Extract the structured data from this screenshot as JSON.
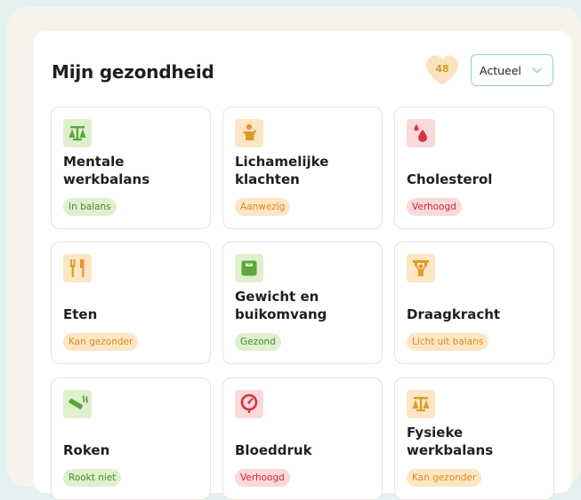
{
  "page": {
    "title": "Mijn gezondheid"
  },
  "score": {
    "value": "48"
  },
  "filter": {
    "selected": "Actueel"
  },
  "cards": [
    {
      "title": "Mentale werkbalans",
      "status": "In balans",
      "icon": "balance-scale-icon"
    },
    {
      "title": "Lichamelijke klachten",
      "status": "Aanwezig",
      "icon": "body-complaint-icon"
    },
    {
      "title": "Cholesterol",
      "status": "Verhoogd",
      "icon": "blood-drops-icon"
    },
    {
      "title": "Eten",
      "status": "Kan gezonder",
      "icon": "fork-knife-icon"
    },
    {
      "title": "Gewicht en buikomvang",
      "status": "Gezond",
      "icon": "weight-scale-icon"
    },
    {
      "title": "Draagkracht",
      "status": "Licht uit balans",
      "icon": "carrying-person-icon"
    },
    {
      "title": "Roken",
      "status": "Rookt niet",
      "icon": "cigarette-icon"
    },
    {
      "title": "Bloeddruk",
      "status": "Verhoogd",
      "icon": "blood-pressure-gauge-icon"
    },
    {
      "title": "Fysieke werkbalans",
      "status": "Kan gezonder",
      "icon": "balance-scale-icon"
    }
  ],
  "colors": {
    "green_bg": "#dff0cf",
    "green_text": "#4a8a2c",
    "green_icon": "#5ea63c",
    "orange_bg": "#fde6c4",
    "orange_text": "#d98a1f",
    "orange_icon": "#e09a2a",
    "red_bg": "#fbd9d9",
    "red_text": "#c8283a",
    "red_icon": "#d63344",
    "heart": "#fbe4bd",
    "select_border": "#8fcfd0"
  }
}
